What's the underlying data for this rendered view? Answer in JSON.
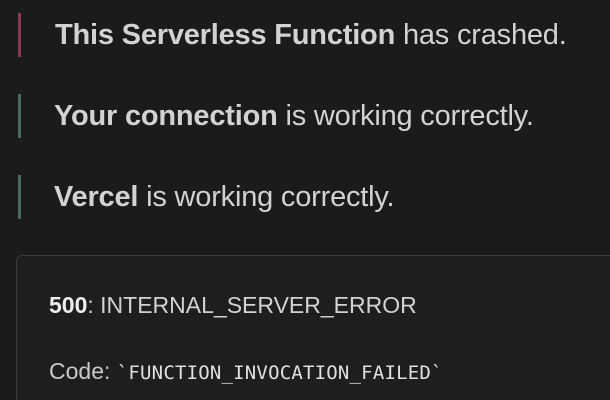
{
  "status": {
    "lines": [
      {
        "bold": "This Serverless Function",
        "rest": " has crashed.",
        "bar_color": "#8a3a4e"
      },
      {
        "bold": "Your connection",
        "rest": " is working correctly.",
        "bar_color": "#4b6b5e"
      },
      {
        "bold": "Vercel",
        "rest": " is working correctly.",
        "bar_color": "#4b6b5e"
      }
    ]
  },
  "error": {
    "status_code": "500",
    "status_text": ": INTERNAL_SERVER_ERROR",
    "code_label": "Code: ",
    "code_value": "`FUNCTION_INVOCATION_FAILED`"
  },
  "colors": {
    "background": "#1b1b1b",
    "text": "#d2d2d2",
    "crash_bar": "#8a3a4e",
    "ok_bar": "#4b6b5e"
  }
}
